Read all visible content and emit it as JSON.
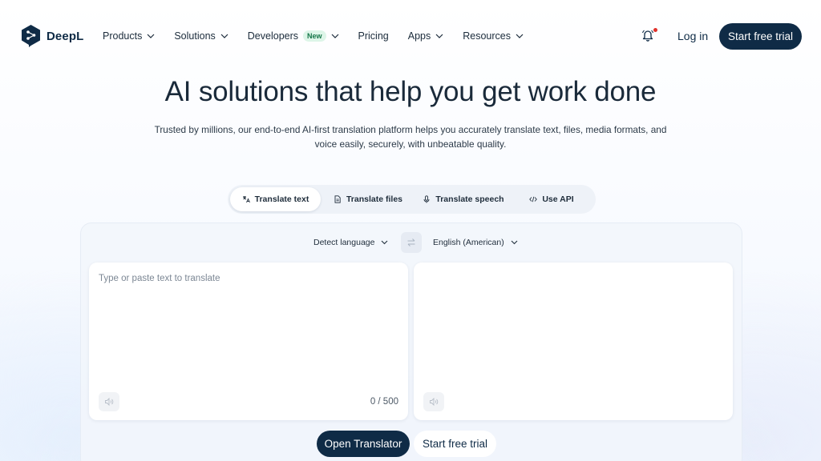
{
  "nav": {
    "logo_text": "DeepL",
    "items": [
      {
        "label": "Products",
        "has_chevron": true
      },
      {
        "label": "Solutions",
        "has_chevron": true
      },
      {
        "label": "Developers",
        "badge": "New",
        "has_chevron": true
      },
      {
        "label": "Pricing",
        "has_chevron": false
      },
      {
        "label": "Apps",
        "has_chevron": true
      },
      {
        "label": "Resources",
        "has_chevron": true
      }
    ],
    "login_label": "Log in",
    "cta_label": "Start free trial"
  },
  "hero": {
    "title": "AI solutions that help you get work done",
    "subtitle": "Trusted by millions, our end-to-end AI-first translation platform helps you accurately translate text, files, media formats, and voice easily, securely, with unbeatable quality."
  },
  "tabs": [
    {
      "label": "Translate text",
      "icon": "translate-text-icon",
      "active": true
    },
    {
      "label": "Translate files",
      "icon": "file-icon",
      "active": false
    },
    {
      "label": "Translate speech",
      "icon": "microphone-icon",
      "active": false
    },
    {
      "label": "Use API",
      "icon": "code-icon",
      "active": false
    }
  ],
  "translator": {
    "source_language": "Detect language",
    "target_language": "English (American)",
    "input_placeholder": "Type or paste text to translate",
    "input_value": "",
    "char_count": "0 / 500"
  },
  "actions": {
    "open_translator_label": "Open Translator",
    "start_trial_label": "Start free trial"
  },
  "colors": {
    "brand_navy": "#0f2b46",
    "new_badge_bg": "#ddf5e8",
    "new_badge_text": "#137547",
    "notification_dot": "#e0312b"
  }
}
